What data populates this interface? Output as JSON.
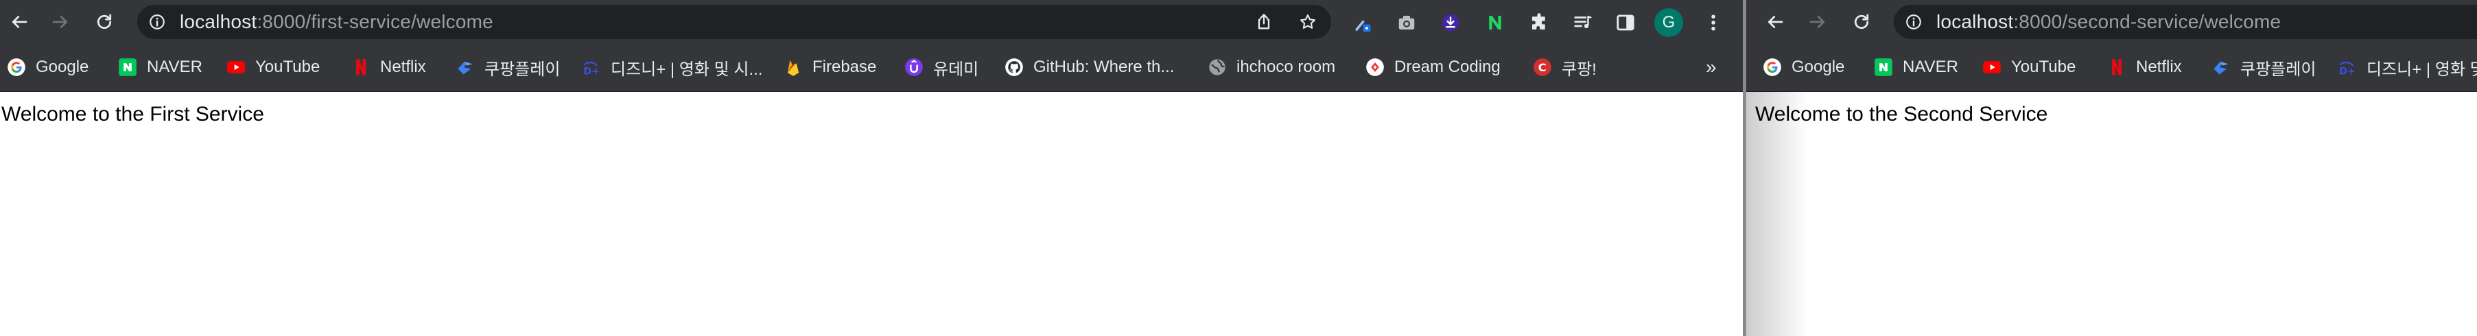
{
  "windows": [
    {
      "url": {
        "host": "localhost",
        "rest": ":8000/first-service/welcome"
      },
      "page_text": "Welcome to the First Service"
    },
    {
      "url": {
        "host": "localhost",
        "rest": ":8000/second-service/welcome"
      },
      "page_text": "Welcome to the Second Service"
    }
  ],
  "bookmarks": [
    {
      "label": "Google",
      "icon": "google-icon"
    },
    {
      "label": "NAVER",
      "icon": "naver-icon"
    },
    {
      "label": "YouTube",
      "icon": "youtube-icon"
    },
    {
      "label": "Netflix",
      "icon": "netflix-icon"
    },
    {
      "label": "쿠팡플레이",
      "icon": "coupang-play-icon"
    },
    {
      "label": "디즈니+ | 영화 및 시...",
      "icon": "disney-plus-icon"
    },
    {
      "label": "Firebase",
      "icon": "firebase-icon"
    },
    {
      "label": "유데미",
      "icon": "udemy-icon"
    },
    {
      "label": "GitHub: Where th...",
      "icon": "github-icon"
    },
    {
      "label": "ihchoco room",
      "icon": "globe-icon"
    },
    {
      "label": "Dream Coding",
      "icon": "dream-coding-icon"
    },
    {
      "label": "쿠팡!",
      "icon": "coupang-icon"
    }
  ],
  "bookmarks_win2": [
    {
      "label": "Google"
    },
    {
      "label": "NAVER"
    },
    {
      "label": "YouTube"
    },
    {
      "label": "Netflix"
    },
    {
      "label": "쿠팡플레이"
    },
    {
      "label": "디즈니+ | 영화 및 시..."
    }
  ],
  "overflow_chevron": "»",
  "profile_initial": "G",
  "colors": {
    "toolbar": "#35363a",
    "omnibox": "#202124",
    "text_light": "#e8eaed",
    "text_dim": "#9aa0a6",
    "avatar": "#00796b"
  }
}
